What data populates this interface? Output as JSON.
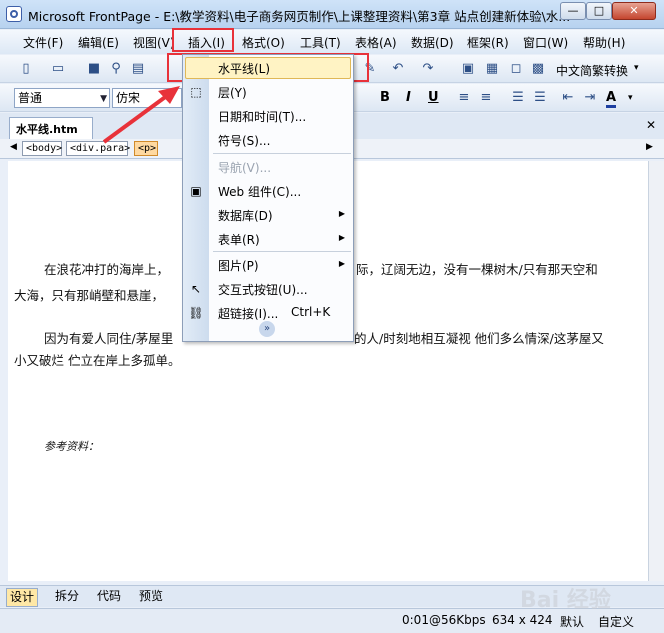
{
  "window": {
    "title": "Microsoft FrontPage - E:\\教学资料\\电子商务网页制作\\上课整理资料\\第3章 站点创建新体验\\水...",
    "min": "—",
    "max": "□",
    "close": "✕"
  },
  "menubar": {
    "items": [
      {
        "label": "文件(F)"
      },
      {
        "label": "编辑(E)"
      },
      {
        "label": "视图(V)"
      },
      {
        "label": "插入(I)"
      },
      {
        "label": "格式(O)"
      },
      {
        "label": "工具(T)"
      },
      {
        "label": "表格(A)"
      },
      {
        "label": "数据(D)"
      },
      {
        "label": "框架(R)"
      },
      {
        "label": "窗口(W)"
      },
      {
        "label": "帮助(H)"
      }
    ]
  },
  "toolbar": {
    "language_button": "中文简繁转换",
    "style_combo": "普通",
    "font_combo": "仿宋",
    "bold": "B",
    "italic": "I",
    "underline": "U",
    "font_color": "A"
  },
  "document": {
    "tab_label": "水平线.htm",
    "tags": [
      "<body>",
      "<div.para>",
      "<p>"
    ],
    "paragraphs": [
      "在浪花冲打的海岸上，",
      "际，辽阔无边，没有一棵树木/只有那天空和",
      "大海，只有那峭壁和悬崖，",
      "因为有爱人同住/茅屋里",
      "的人/时刻地相互凝视 他们多么情深/这茅屋又",
      "小又破烂 伫立在岸上多孤单。",
      "参考资料："
    ],
    "fragment_right": "麦）"
  },
  "insert_menu": {
    "items": [
      {
        "label": "水平线(L)",
        "icon": "horizontal-line-icon"
      },
      {
        "label": "层(Y)",
        "icon": "layer-icon"
      },
      {
        "label": "日期和时间(T)..."
      },
      {
        "label": "符号(S)..."
      },
      {
        "label": "导航(V)...",
        "disabled": true
      },
      {
        "label": "Web 组件(C)...",
        "icon": "web-component-icon"
      },
      {
        "label": "数据库(D)",
        "submenu": true
      },
      {
        "label": "表单(R)",
        "submenu": true
      },
      {
        "label": "图片(P)",
        "submenu": true
      },
      {
        "label": "交互式按钮(U)...",
        "icon": "interactive-button-icon"
      },
      {
        "label": "超链接(I)...",
        "shortcut": "Ctrl+K",
        "icon": "hyperlink-icon"
      }
    ],
    "more": "»"
  },
  "view_tabs": {
    "items": [
      "设计",
      "拆分",
      "代码",
      "预览"
    ]
  },
  "status": {
    "speed": "0:01@56Kbps",
    "size": "634 x 424",
    "default": "默认",
    "custom": "自定义"
  },
  "watermark": "Bai 经验"
}
